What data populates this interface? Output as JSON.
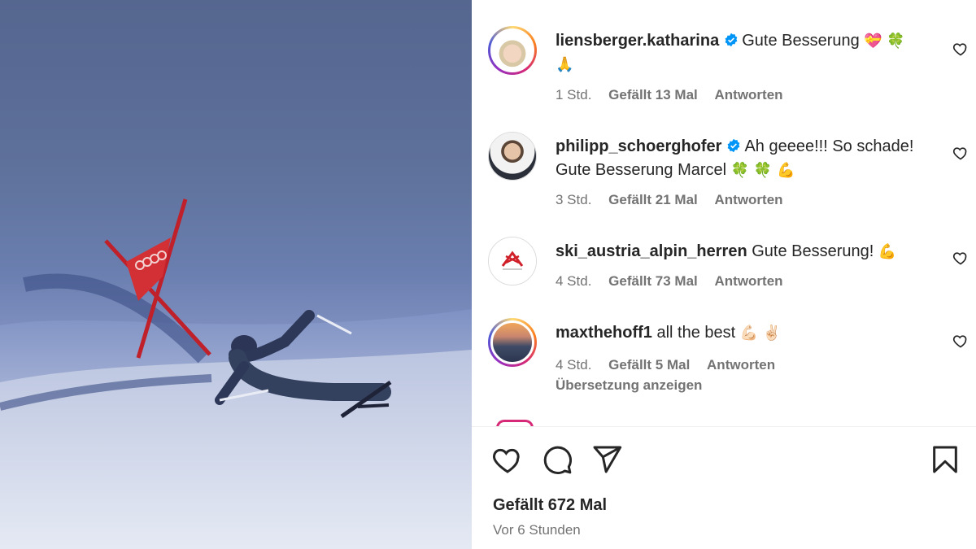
{
  "post": {
    "likes_text": "Gefällt 672 Mal",
    "time_text": "Vor 6 Stunden"
  },
  "comments": [
    {
      "username": "liensberger.katharina",
      "verified": true,
      "text": "Gute Besserung",
      "emojis": "💝 🍀",
      "emojis_line2": "🙏",
      "time": "1 Std.",
      "likes": "Gefällt 13 Mal",
      "reply": "Antworten"
    },
    {
      "username": "philipp_schoerghofer",
      "verified": true,
      "text": "Ah geeee!!! So schade!",
      "text_line2": "Gute Besserung Marcel",
      "emojis": "🍀 🍀 💪",
      "time": "3 Std.",
      "likes": "Gefällt 21 Mal",
      "reply": "Antworten"
    },
    {
      "username": "ski_austria_alpin_herren",
      "verified": false,
      "text": "Gute Besserung!",
      "emojis": "💪",
      "time": "4 Std.",
      "likes": "Gefällt 73 Mal",
      "reply": "Antworten"
    },
    {
      "username": "maxthehoff1",
      "verified": false,
      "text": "all the best",
      "emojis": "💪🏻 ✌🏻",
      "time": "4 Std.",
      "likes": "Gefällt 5 Mal",
      "reply": "Antworten",
      "translate": "Übersetzung anzeigen"
    }
  ],
  "icons": {
    "like": "heart-icon",
    "comment": "comment-icon",
    "share": "share-icon",
    "save": "bookmark-icon",
    "verified": "verified-badge-icon"
  },
  "colors": {
    "verified": "#0095f6",
    "text": "#262626",
    "meta": "#737373",
    "story_ring": "#d62976"
  }
}
